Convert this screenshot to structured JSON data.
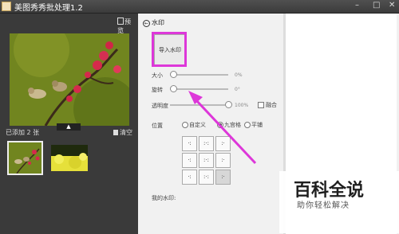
{
  "app": {
    "title": "美图秀秀批处理1.2"
  },
  "left": {
    "preview_label": "预览",
    "added_label": "已添加 2 张",
    "clear_label": "清空"
  },
  "right": {
    "back_label": "水印",
    "import_button": "导入水印",
    "size_label": "大小",
    "size_value": "0%",
    "rotate_label": "旋转",
    "rotate_value": "0°",
    "opacity_label": "透明度",
    "opacity_value": "100%",
    "blend_label": "融合",
    "position_label": "位置",
    "position_options": [
      "自定义",
      "九宫格",
      "平铺"
    ],
    "my_watermark_label": "我的水印:"
  },
  "overlay": {
    "title": "百科全说",
    "subtitle": "助你轻松解决"
  },
  "colors": {
    "highlight": "#dd37d9",
    "arrow": "#dd37d9"
  }
}
